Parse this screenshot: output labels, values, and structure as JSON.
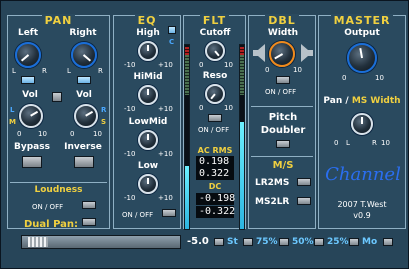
{
  "pan": {
    "title": "PAN",
    "left_label": "Left",
    "right_label": "Right",
    "scale_l": "L",
    "scale_r": "R",
    "vol_label": "Vol",
    "vol_zero": "0",
    "vol_ten": "10",
    "marker_l": "L",
    "marker_m": "M",
    "marker_r": "R",
    "marker_s": "S",
    "bypass_label": "Bypass",
    "inverse_label": "Inverse",
    "loudness_label": "Loudness",
    "onoff_label": "ON / OFF",
    "dualpan_label": "Dual Pan:"
  },
  "eq": {
    "title": "EQ",
    "bands": [
      {
        "label": "High",
        "min": "-10",
        "max": "+10"
      },
      {
        "label": "HiMid",
        "min": "-10",
        "max": "+10"
      },
      {
        "label": "LowMid",
        "min": "-10",
        "max": "+10"
      },
      {
        "label": "Low",
        "min": "-10",
        "max": "+10"
      }
    ],
    "c_label": "C",
    "onoff_label": "ON / OFF"
  },
  "flt": {
    "title": "FLT",
    "cutoff_label": "Cutoff",
    "cutoff_min": "0",
    "cutoff_max": "10",
    "reso_label": "Reso",
    "reso_min": "0",
    "reso_max": "10",
    "onoff_label": "ON / OFF",
    "acrms_label": "AC RMS",
    "acrms_l": "0.198",
    "acrms_r": "0.322",
    "dc_label": "DC",
    "dc_l": "-0.198",
    "dc_r": "-0.322",
    "meter_left_level": 0.34,
    "meter_right_level": 0.58
  },
  "dbl": {
    "title": "DBL",
    "width_label": "Width",
    "width_min": "0",
    "width_max": "10",
    "onoff_label": "ON / OFF",
    "pitch_label": "Pitch",
    "doubler_label": "Doubler"
  },
  "ms": {
    "title": "M/S",
    "lr2ms_label": "LR2MS",
    "ms2lr_label": "MS2LR"
  },
  "master": {
    "title": "MASTER",
    "output_label": "Output",
    "output_min": "0",
    "output_max": "10",
    "panms_label_a": "Pan /",
    "panms_label_b": "MS Width",
    "pan_min": "0",
    "pan_l": "L",
    "pan_r": "R",
    "pan_max": "10",
    "logo": "Channel",
    "credit": "2007 T.West",
    "version": "v0.9"
  },
  "bottom": {
    "value": "-5.0",
    "st_label": "St",
    "p75_label": "75%",
    "p50_label": "50%",
    "p25_label": "25%",
    "mo_label": "Mo"
  },
  "colors": {
    "panel_bg": "#2a4a5f",
    "title_yellow": "#f0d040",
    "knob_ring_blue": "#1a6ed8",
    "knob_ring_orange": "#f08a1c",
    "meter_fill": "#2cb4e0"
  }
}
